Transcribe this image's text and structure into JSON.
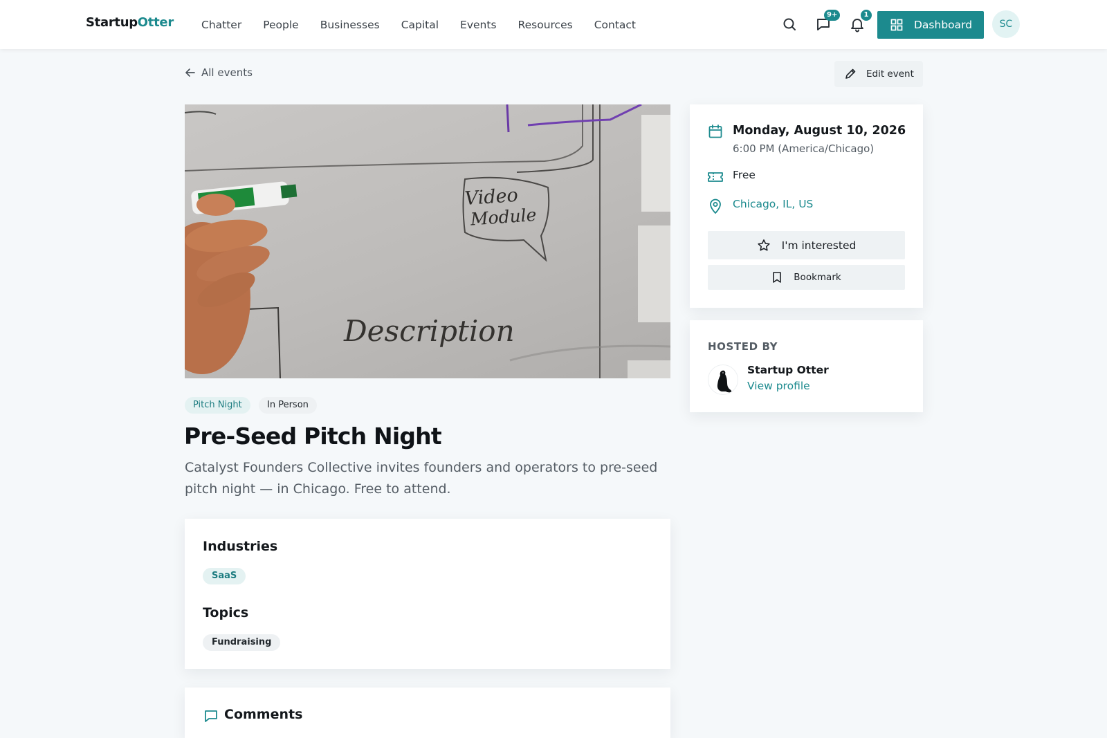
{
  "header": {
    "logo_part1": "Startup",
    "logo_part2": "Otter",
    "nav": [
      "Chatter",
      "People",
      "Businesses",
      "Capital",
      "Events",
      "Resources",
      "Contact"
    ],
    "messages_badge": "9+",
    "notifications_badge": "1",
    "dashboard_label": "Dashboard",
    "avatar_initials": "SC"
  },
  "breadcrumb": {
    "back_label": "All events",
    "edit_label": "Edit event"
  },
  "event": {
    "tags": [
      "Pitch Night",
      "In Person"
    ],
    "title": "Pre-Seed Pitch Night",
    "description": "Catalyst Founders Collective invites founders and operators to pre-seed pitch night — in Chicago. Free to attend.",
    "image_whiteboard_text": [
      "Video",
      "Module",
      "Description"
    ]
  },
  "details": {
    "industries_heading": "Industries",
    "industries": [
      "SaaS"
    ],
    "topics_heading": "Topics",
    "topics": [
      "Fundraising"
    ]
  },
  "comments": {
    "heading": "Comments"
  },
  "sidebar": {
    "date": "Monday, August 10, 2026",
    "time": "6:00 PM (America/Chicago)",
    "price": "Free",
    "location": "Chicago, IL, US",
    "interested_label": "I'm interested",
    "bookmark_label": "Bookmark"
  },
  "host": {
    "heading": "HOSTED BY",
    "name": "Startup Otter",
    "link_label": "View profile"
  },
  "colors": {
    "accent": "#1c8a8e",
    "page_bg": "#f5f8fa"
  }
}
